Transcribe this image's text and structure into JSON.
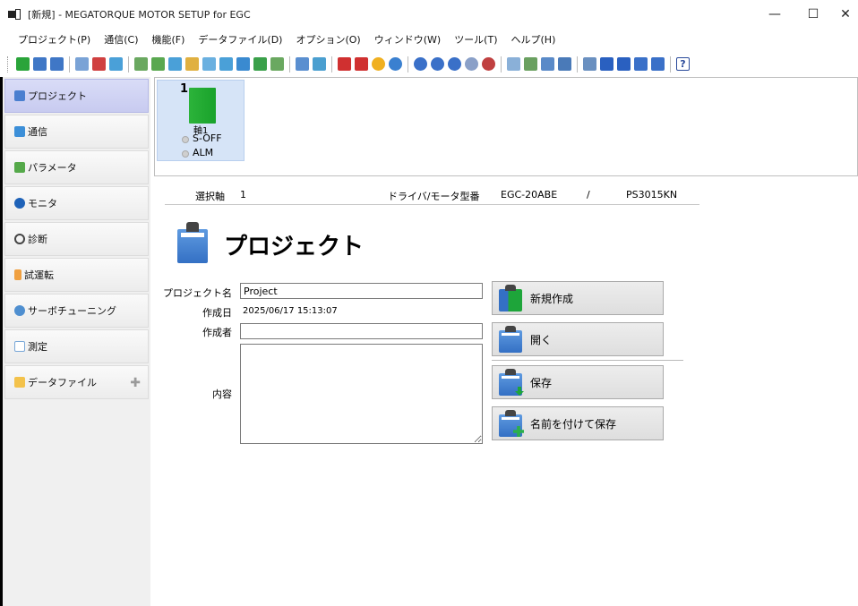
{
  "window": {
    "title": "[新規] - MEGATORQUE MOTOR SETUP for EGC",
    "minimize": "—",
    "maximize": "☐",
    "close": "✕"
  },
  "menu": [
    "プロジェクト(P)",
    "通信(C)",
    "機能(F)",
    "データファイル(D)",
    "オプション(O)",
    "ウィンドウ(W)",
    "ツール(T)",
    "ヘルプ(H)"
  ],
  "toolbar_icons": [
    "project-new-icon",
    "project-open-icon",
    "project-save-icon",
    "connect-icon",
    "disconnect-icon",
    "comm-settings-icon",
    "param-read-icon",
    "param-write-icon",
    "param-compare-icon",
    "param-edit-icon",
    "param-init-icon",
    "param-backup-icon",
    "param-upload-icon",
    "param-download-icon",
    "param-copy-icon",
    "monitor-icon",
    "io-monitor-icon",
    "alarm-icon",
    "alarm-history-icon",
    "warning-icon",
    "network-icon",
    "jog-icon",
    "program-icon",
    "positioning-icon",
    "home-return-icon",
    "test-run-icon",
    "waveform-icon",
    "measurement-icon",
    "frequency-icon",
    "graph-icon",
    "tuning-icon",
    "servo-on-icon",
    "servo-off-icon",
    "user-icon",
    "settings-icon",
    "help-icon"
  ],
  "sidebar": {
    "items": [
      {
        "label": "プロジェクト",
        "icon": "clipboard-icon",
        "color": "#4a7fd0"
      },
      {
        "label": "通信",
        "icon": "communication-icon",
        "color": "#3c8fd8"
      },
      {
        "label": "パラメータ",
        "icon": "parameter-icon",
        "color": "#55a94a"
      },
      {
        "label": "モニタ",
        "icon": "monitor-icon",
        "color": "#1e62b8"
      },
      {
        "label": "診断",
        "icon": "magnifier-icon",
        "color": "#444444"
      },
      {
        "label": "試運転",
        "icon": "hand-icon",
        "color": "#f0a040"
      },
      {
        "label": "サーボチューニング",
        "icon": "gears-icon",
        "color": "#4f8fd0"
      },
      {
        "label": "測定",
        "icon": "measurement-icon",
        "color": "#7aa8d8"
      },
      {
        "label": "データファイル",
        "icon": "folder-icon",
        "color": "#f3c24b"
      }
    ],
    "plus": "✚"
  },
  "axis": {
    "number": "1",
    "name": "軸1",
    "status1": "S-OFF",
    "status2": "ALM"
  },
  "info": {
    "selected_axis_label": "選択軸",
    "selected_axis_value": "1",
    "model_label": "ドライバ/モータ型番",
    "driver_model": "EGC-20ABE",
    "slash": "/",
    "motor_model": "PS3015KN"
  },
  "page_title": "プロジェクト",
  "form": {
    "project_name_label": "プロジェクト名",
    "project_name_value": "Project",
    "created_label": "作成日",
    "created_value": "2025/06/17 15:13:07",
    "author_label": "作成者",
    "author_value": "",
    "content_label": "内容",
    "content_value": ""
  },
  "actions": {
    "new": "新規作成",
    "open": "開く",
    "save": "保存",
    "save_as": "名前を付けて保存"
  }
}
